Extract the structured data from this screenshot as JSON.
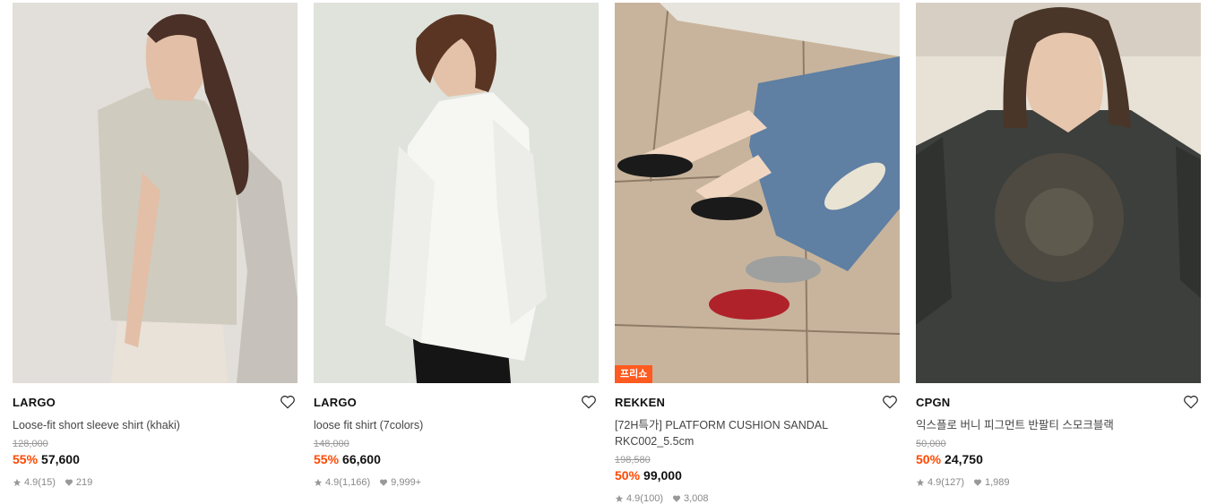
{
  "colors": {
    "discount": "#ff4800",
    "free_return_tag": "#ff5a1f"
  },
  "products": [
    {
      "brand": "LARGO",
      "name": "Loose-fit short sleeve shirt (khaki)",
      "original_price": "128,000",
      "discount": "55%",
      "price": "57,600",
      "rating": "4.9",
      "reviews": "(15)",
      "likes": "219",
      "tag": ""
    },
    {
      "brand": "LARGO",
      "name": "loose fit shirt (7colors)",
      "original_price": "148,000",
      "discount": "55%",
      "price": "66,600",
      "rating": "4.9",
      "reviews": "(1,166)",
      "likes": "9,999+",
      "tag": ""
    },
    {
      "brand": "REKKEN",
      "name": "[72H특가] PLATFORM CUSHION SANDAL RKC002_5.5cm",
      "original_price": "198,580",
      "discount": "50%",
      "price": "99,000",
      "rating": "4.9",
      "reviews": "(100)",
      "likes": "3,008",
      "tag": "프리쇼"
    },
    {
      "brand": "CPGN",
      "name": "익스플로 버니 피그먼트 반팔티 스모크블랙",
      "original_price": "50,000",
      "discount": "50%",
      "price": "24,750",
      "rating": "4.9",
      "reviews": "(127)",
      "likes": "1,989",
      "tag": ""
    }
  ]
}
